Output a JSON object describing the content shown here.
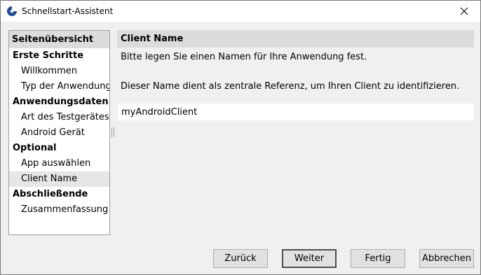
{
  "window": {
    "title": "Schnellstart-Assistent",
    "app_icon": "app-logo-icon",
    "close_icon": "close-icon"
  },
  "sidebar": {
    "header": "Seitenübersicht",
    "items": [
      {
        "label": "Erste Schritte",
        "type": "section"
      },
      {
        "label": "Willkommen",
        "type": "entry"
      },
      {
        "label": "Typ der Anwendung",
        "type": "entry"
      },
      {
        "label": "Anwendungsdaten",
        "type": "section"
      },
      {
        "label": "Art des Testgerätes",
        "type": "entry"
      },
      {
        "label": "Android Gerät",
        "type": "entry"
      },
      {
        "label": "Optional",
        "type": "section"
      },
      {
        "label": "App auswählen",
        "type": "entry"
      },
      {
        "label": "Client Name",
        "type": "entry",
        "selected": true
      },
      {
        "label": "Abschließende",
        "type": "section"
      },
      {
        "label": "Zusammenfassung",
        "type": "entry"
      }
    ]
  },
  "content": {
    "header": "Client Name",
    "description_1": "Bitte legen Sie einen Namen für Ihre Anwendung fest.",
    "description_2": "Dieser Name dient als zentrale Referenz, um Ihren Client zu identifizieren.",
    "client_name_value": "myAndroidClient"
  },
  "buttons": {
    "back": "Zurück",
    "next": "Weiter",
    "finish": "Fertig",
    "cancel": "Abbrechen"
  },
  "colors": {
    "accent": "#1f4e9a",
    "header_bg": "#dcdcdc",
    "selected_bg": "#e6e6e6"
  }
}
